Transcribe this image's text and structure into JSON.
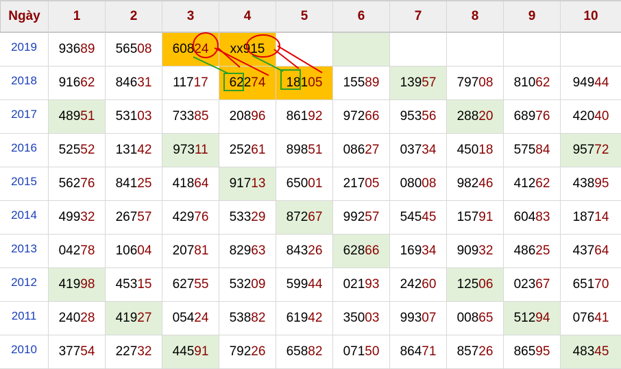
{
  "table": {
    "header": [
      "Ngày",
      "1",
      "2",
      "3",
      "4",
      "5",
      "6",
      "7",
      "8",
      "9",
      "10"
    ],
    "rows": [
      {
        "year": "2019",
        "cells": [
          {
            "v": "93689",
            "bg": ""
          },
          {
            "v": "56508",
            "bg": ""
          },
          {
            "v": "60824",
            "bg": "o"
          },
          {
            "v": "xx915",
            "bg": "o"
          },
          {
            "v": "",
            "bg": ""
          },
          {
            "v": "",
            "bg": "g"
          },
          {
            "v": "",
            "bg": ""
          },
          {
            "v": "",
            "bg": ""
          },
          {
            "v": "",
            "bg": ""
          },
          {
            "v": "",
            "bg": ""
          }
        ]
      },
      {
        "year": "2018",
        "cells": [
          {
            "v": "91662",
            "bg": ""
          },
          {
            "v": "84631",
            "bg": ""
          },
          {
            "v": "11717",
            "bg": ""
          },
          {
            "v": "62274",
            "bg": "o"
          },
          {
            "v": "18105",
            "bg": "o"
          },
          {
            "v": "15589",
            "bg": ""
          },
          {
            "v": "13957",
            "bg": "g"
          },
          {
            "v": "79708",
            "bg": ""
          },
          {
            "v": "81062",
            "bg": ""
          },
          {
            "v": "94944",
            "bg": ""
          }
        ]
      },
      {
        "year": "2017",
        "cells": [
          {
            "v": "48951",
            "bg": "g"
          },
          {
            "v": "53103",
            "bg": ""
          },
          {
            "v": "73385",
            "bg": ""
          },
          {
            "v": "20896",
            "bg": ""
          },
          {
            "v": "86192",
            "bg": ""
          },
          {
            "v": "97266",
            "bg": ""
          },
          {
            "v": "95356",
            "bg": ""
          },
          {
            "v": "28820",
            "bg": "g"
          },
          {
            "v": "68976",
            "bg": ""
          },
          {
            "v": "42040",
            "bg": ""
          }
        ]
      },
      {
        "year": "2016",
        "cells": [
          {
            "v": "52552",
            "bg": ""
          },
          {
            "v": "13142",
            "bg": ""
          },
          {
            "v": "97311",
            "bg": "g"
          },
          {
            "v": "25261",
            "bg": ""
          },
          {
            "v": "89851",
            "bg": ""
          },
          {
            "v": "08627",
            "bg": ""
          },
          {
            "v": "03734",
            "bg": ""
          },
          {
            "v": "45018",
            "bg": ""
          },
          {
            "v": "57584",
            "bg": ""
          },
          {
            "v": "95772",
            "bg": "g"
          }
        ]
      },
      {
        "year": "2015",
        "cells": [
          {
            "v": "56276",
            "bg": ""
          },
          {
            "v": "84125",
            "bg": ""
          },
          {
            "v": "41864",
            "bg": ""
          },
          {
            "v": "91713",
            "bg": "g"
          },
          {
            "v": "65001",
            "bg": ""
          },
          {
            "v": "21705",
            "bg": ""
          },
          {
            "v": "08008",
            "bg": ""
          },
          {
            "v": "98246",
            "bg": ""
          },
          {
            "v": "41262",
            "bg": ""
          },
          {
            "v": "43895",
            "bg": ""
          }
        ]
      },
      {
        "year": "2014",
        "cells": [
          {
            "v": "49932",
            "bg": ""
          },
          {
            "v": "26757",
            "bg": ""
          },
          {
            "v": "42976",
            "bg": ""
          },
          {
            "v": "53329",
            "bg": ""
          },
          {
            "v": "87267",
            "bg": "g"
          },
          {
            "v": "99257",
            "bg": ""
          },
          {
            "v": "54545",
            "bg": ""
          },
          {
            "v": "15791",
            "bg": ""
          },
          {
            "v": "60483",
            "bg": ""
          },
          {
            "v": "18714",
            "bg": ""
          }
        ]
      },
      {
        "year": "2013",
        "cells": [
          {
            "v": "04278",
            "bg": ""
          },
          {
            "v": "10604",
            "bg": ""
          },
          {
            "v": "20781",
            "bg": ""
          },
          {
            "v": "82963",
            "bg": ""
          },
          {
            "v": "84326",
            "bg": ""
          },
          {
            "v": "62866",
            "bg": "g"
          },
          {
            "v": "16934",
            "bg": ""
          },
          {
            "v": "90932",
            "bg": ""
          },
          {
            "v": "48625",
            "bg": ""
          },
          {
            "v": "43764",
            "bg": ""
          }
        ]
      },
      {
        "year": "2012",
        "cells": [
          {
            "v": "41998",
            "bg": "g"
          },
          {
            "v": "45315",
            "bg": ""
          },
          {
            "v": "62755",
            "bg": ""
          },
          {
            "v": "53209",
            "bg": ""
          },
          {
            "v": "59944",
            "bg": ""
          },
          {
            "v": "02193",
            "bg": ""
          },
          {
            "v": "24260",
            "bg": ""
          },
          {
            "v": "12506",
            "bg": "g"
          },
          {
            "v": "02367",
            "bg": ""
          },
          {
            "v": "65170",
            "bg": ""
          }
        ]
      },
      {
        "year": "2011",
        "cells": [
          {
            "v": "24028",
            "bg": ""
          },
          {
            "v": "41927",
            "bg": "g"
          },
          {
            "v": "05424",
            "bg": ""
          },
          {
            "v": "53882",
            "bg": ""
          },
          {
            "v": "61942",
            "bg": ""
          },
          {
            "v": "35003",
            "bg": ""
          },
          {
            "v": "99307",
            "bg": ""
          },
          {
            "v": "00865",
            "bg": ""
          },
          {
            "v": "51294",
            "bg": "g"
          },
          {
            "v": "07641",
            "bg": ""
          }
        ]
      },
      {
        "year": "2010",
        "cells": [
          {
            "v": "37754",
            "bg": ""
          },
          {
            "v": "22732",
            "bg": ""
          },
          {
            "v": "44591",
            "bg": "g"
          },
          {
            "v": "79226",
            "bg": ""
          },
          {
            "v": "65882",
            "bg": ""
          },
          {
            "v": "07150",
            "bg": ""
          },
          {
            "v": "86471",
            "bg": ""
          },
          {
            "v": "85726",
            "bg": ""
          },
          {
            "v": "86595",
            "bg": ""
          },
          {
            "v": "48345",
            "bg": "g"
          }
        ]
      }
    ]
  },
  "colors": {
    "header_text": "#8b0000",
    "year_text": "#1a3fb8",
    "tail_digits": "#8b0000",
    "highlight_orange": "#ffc000",
    "highlight_green": "#e2f0d9",
    "annotation_red": "#e00000",
    "annotation_green": "#2aa02a"
  }
}
